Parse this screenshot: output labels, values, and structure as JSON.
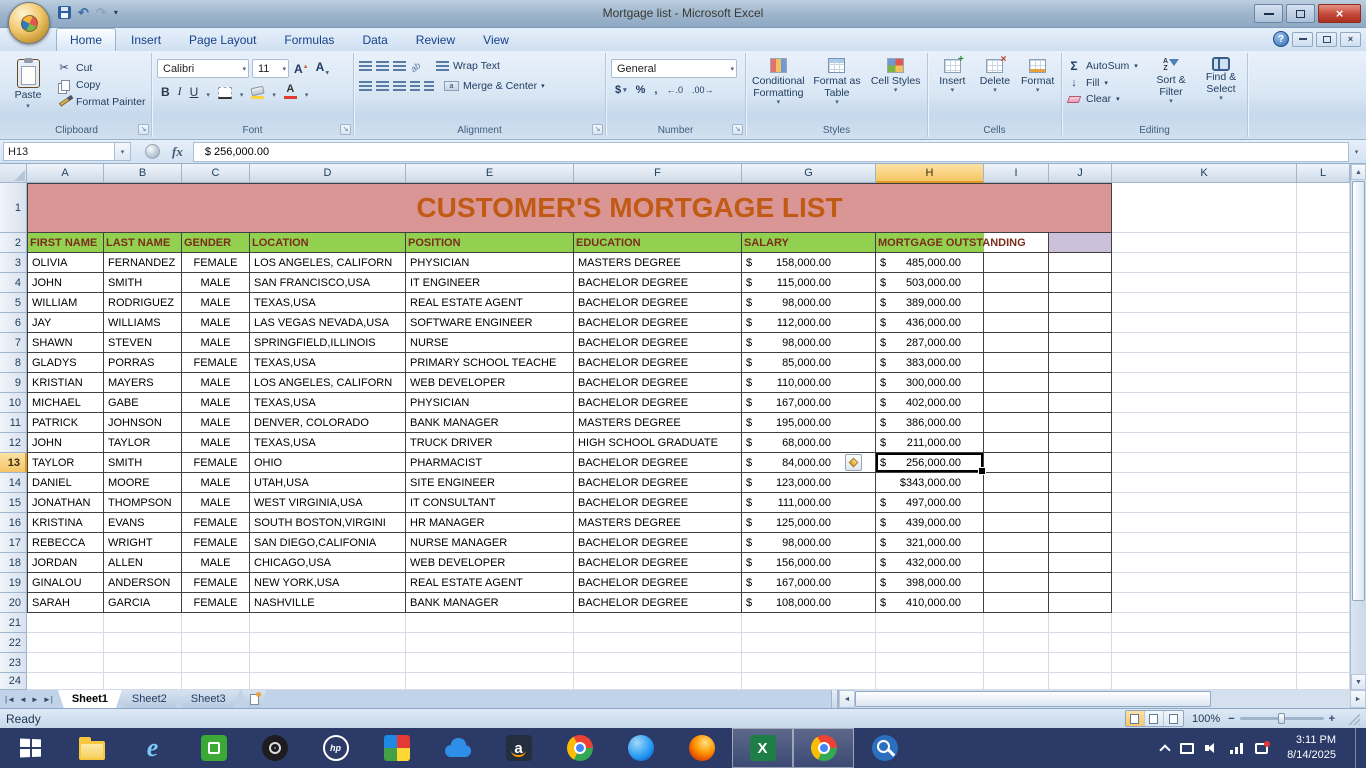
{
  "window": {
    "title": "Mortgage list - Microsoft Excel"
  },
  "ribbon": {
    "tabs": [
      {
        "label": "Home",
        "active": true
      },
      {
        "label": "Insert"
      },
      {
        "label": "Page Layout"
      },
      {
        "label": "Formulas"
      },
      {
        "label": "Data"
      },
      {
        "label": "Review"
      },
      {
        "label": "View"
      }
    ],
    "clipboard": {
      "title": "Clipboard",
      "paste": "Paste",
      "cut": "Cut",
      "copy": "Copy",
      "format_painter": "Format Painter"
    },
    "font": {
      "title": "Font",
      "family": "Calibri",
      "size": "11",
      "bold": "B",
      "italic": "I",
      "underline": "U"
    },
    "alignment": {
      "title": "Alignment",
      "wrap_text": "Wrap Text",
      "merge_center": "Merge & Center"
    },
    "number": {
      "title": "Number",
      "format": "General",
      "currency": "$",
      "percent": "%",
      "comma": ","
    },
    "styles": {
      "title": "Styles",
      "conditional": "Conditional Formatting",
      "format_table": "Format as Table",
      "cell_styles": "Cell Styles"
    },
    "cells": {
      "title": "Cells",
      "insert": "Insert",
      "delete": "Delete",
      "format": "Format"
    },
    "editing": {
      "title": "Editing",
      "autosum": "AutoSum",
      "fill": "Fill",
      "clear": "Clear",
      "sort": "Sort & Filter",
      "find": "Find & Select"
    }
  },
  "formula_bar": {
    "name_box": "H13",
    "value": "$ 256,000.00"
  },
  "sheet": {
    "columns": [
      "A",
      "B",
      "C",
      "D",
      "E",
      "F",
      "G",
      "H",
      "I",
      "J",
      "K",
      "L"
    ],
    "row_count": 24,
    "active_cell": {
      "col": "H",
      "row": 13
    },
    "title": "CUSTOMER'S MORTGAGE LIST",
    "headers": [
      "FIRST NAME",
      "LAST NAME",
      "GENDER",
      "LOCATION",
      "POSITION",
      "EDUCATION",
      "SALARY",
      "MORTGAGE OUTSTANDING"
    ],
    "records": [
      {
        "first": "OLIVIA",
        "last": "FERNANDEZ",
        "gender": "FEMALE",
        "location": "LOS ANGELES, CALIFORN",
        "position": "PHYSICIAN",
        "education": "MASTERS DEGREE",
        "salary": "158,000.00",
        "mortgage": "485,000.00"
      },
      {
        "first": "JOHN",
        "last": "SMITH",
        "gender": "MALE",
        "location": "SAN FRANCISCO,USA",
        "position": "IT ENGINEER",
        "education": "BACHELOR DEGREE",
        "salary": "115,000.00",
        "mortgage": "503,000.00"
      },
      {
        "first": "WILLIAM",
        "last": "RODRIGUEZ",
        "gender": "MALE",
        "location": "TEXAS,USA",
        "position": "REAL ESTATE AGENT",
        "education": "BACHELOR DEGREE",
        "salary": "98,000.00",
        "mortgage": "389,000.00"
      },
      {
        "first": "JAY",
        "last": "WILLIAMS",
        "gender": "MALE",
        "location": "LAS VEGAS NEVADA,USA",
        "position": "SOFTWARE ENGINEER",
        "education": "BACHELOR DEGREE",
        "salary": "112,000.00",
        "mortgage": "436,000.00"
      },
      {
        "first": "SHAWN",
        "last": "STEVEN",
        "gender": "MALE",
        "location": "SPRINGFIELD,ILLINOIS",
        "position": "NURSE",
        "education": "BACHELOR DEGREE",
        "salary": "98,000.00",
        "mortgage": "287,000.00"
      },
      {
        "first": "GLADYS",
        "last": "PORRAS",
        "gender": "FEMALE",
        "location": "TEXAS,USA",
        "position": "PRIMARY SCHOOL TEACHE",
        "education": "BACHELOR DEGREE",
        "salary": "85,000.00",
        "mortgage": "383,000.00"
      },
      {
        "first": "KRISTIAN",
        "last": "MAYERS",
        "gender": "MALE",
        "location": "LOS ANGELES, CALIFORN",
        "position": "WEB DEVELOPER",
        "education": "BACHELOR DEGREE",
        "salary": "110,000.00",
        "mortgage": "300,000.00"
      },
      {
        "first": "MICHAEL",
        "last": "GABE",
        "gender": "MALE",
        "location": "TEXAS,USA",
        "position": "PHYSICIAN",
        "education": "BACHELOR DEGREE",
        "salary": "167,000.00",
        "mortgage": "402,000.00"
      },
      {
        "first": "PATRICK",
        "last": "JOHNSON",
        "gender": "MALE",
        "location": "DENVER, COLORADO",
        "position": "BANK MANAGER",
        "education": "MASTERS DEGREE",
        "salary": "195,000.00",
        "mortgage": "386,000.00"
      },
      {
        "first": "JOHN",
        "last": "TAYLOR",
        "gender": "MALE",
        "location": "TEXAS,USA",
        "position": "TRUCK DRIVER",
        "education": "HIGH SCHOOL GRADUATE",
        "salary": "68,000.00",
        "mortgage": "211,000.00"
      },
      {
        "first": "TAYLOR",
        "last": "SMITH",
        "gender": "FEMALE",
        "location": "OHIO",
        "position": "PHARMACIST",
        "education": "BACHELOR DEGREE",
        "salary": "84,000.00",
        "mortgage": "256,000.00"
      },
      {
        "first": "DANIEL",
        "last": "MOORE",
        "gender": "MALE",
        "location": "UTAH,USA",
        "position": "SITE ENGINEER",
        "education": "BACHELOR DEGREE",
        "salary": "123,000.00",
        "mortgage": "343,000.00",
        "mortgage_plain": true
      },
      {
        "first": "JONATHAN",
        "last": "THOMPSON",
        "gender": "MALE",
        "location": "WEST VIRGINIA,USA",
        "position": "IT CONSULTANT",
        "education": "BACHELOR DEGREE",
        "salary": "111,000.00",
        "mortgage": "497,000.00"
      },
      {
        "first": "KRISTINA",
        "last": "EVANS",
        "gender": "FEMALE",
        "location": "SOUTH BOSTON,VIRGINI",
        "position": "HR MANAGER",
        "education": "MASTERS DEGREE",
        "salary": "125,000.00",
        "mortgage": "439,000.00"
      },
      {
        "first": "REBECCA",
        "last": "WRIGHT",
        "gender": "FEMALE",
        "location": "SAN DIEGO,CALIFONIA",
        "position": "NURSE MANAGER",
        "education": "BACHELOR DEGREE",
        "salary": "98,000.00",
        "mortgage": "321,000.00"
      },
      {
        "first": "JORDAN",
        "last": "ALLEN",
        "gender": "MALE",
        "location": "CHICAGO,USA",
        "position": "WEB DEVELOPER",
        "education": "BACHELOR DEGREE",
        "salary": "156,000.00",
        "mortgage": "432,000.00"
      },
      {
        "first": "GINALOU",
        "last": "ANDERSON",
        "gender": "FEMALE",
        "location": "NEW YORK,USA",
        "position": "REAL ESTATE AGENT",
        "education": "BACHELOR DEGREE",
        "salary": "167,000.00",
        "mortgage": "398,000.00"
      },
      {
        "first": "SARAH",
        "last": "GARCIA",
        "gender": "FEMALE",
        "location": "NASHVILLE",
        "position": "BANK MANAGER",
        "education": "BACHELOR DEGREE",
        "salary": "108,000.00",
        "mortgage": "410,000.00"
      }
    ]
  },
  "sheet_tabs": {
    "names": [
      "Sheet1",
      "Sheet2",
      "Sheet3"
    ],
    "active": "Sheet1"
  },
  "status_bar": {
    "mode": "Ready",
    "zoom": "100%"
  },
  "taskbar": {
    "time": "3:11 PM",
    "date": "8/14/2025",
    "icons": [
      "start",
      "file-explorer",
      "internet-explorer",
      "green-app",
      "media-disc",
      "hp",
      "photos",
      "cloud",
      "amazon",
      "chrome",
      "blue-browser",
      "firefox",
      "excel",
      "google-app",
      "search"
    ],
    "open_apps": [
      "excel",
      "google-app"
    ]
  }
}
